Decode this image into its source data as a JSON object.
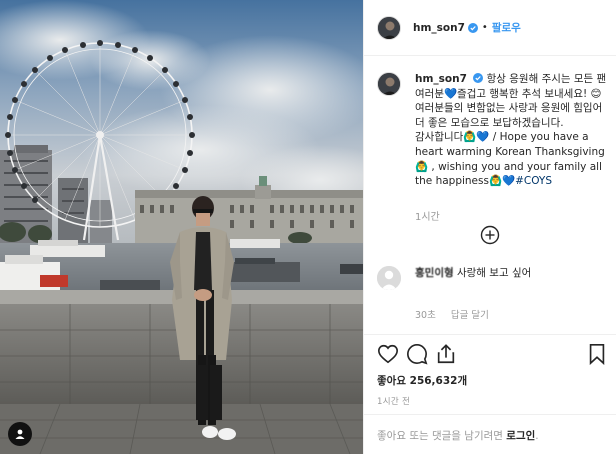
{
  "header": {
    "username": "hm_son7",
    "separator": "•",
    "follow_label": "팔로우"
  },
  "caption": {
    "username": "hm_son7",
    "text": "항상 응원해 주시는 모든 팬 여러분💙즐겁고 행복한 추석 보내세요! 😊 여러분들의 변함없는 사랑과 응원에 힘입어 더 좋은 모습으로 보답하겠습니다. 감사합니다🙆‍♂️💙 / Hope you have a heart warming Korean Thanksgiving 🙆‍♂️ , wishing you and your family all the happiness🙆‍♂️💙",
    "hashtag": "#COYS",
    "time": "1시간"
  },
  "comment": {
    "username": "흥민이형",
    "text": "사랑해 보고 싶어",
    "time": "30초",
    "reply_label": "답글 달기"
  },
  "likes": {
    "label": "좋아요",
    "count": "256,632개"
  },
  "posted_time": "1시간 전",
  "login_prompt": {
    "text": "좋아요 또는 댓글을 남기려면",
    "link": "로그인",
    "suffix": "."
  },
  "colors": {
    "link_blue": "#3897f0",
    "hashtag_blue": "#003569",
    "muted_gray": "#999999",
    "divider": "#efefef"
  },
  "icons": [
    "verified-badge-icon",
    "add-comment-plus-icon",
    "heart-icon",
    "comment-icon",
    "share-icon",
    "bookmark-icon",
    "user-tag-icon"
  ]
}
